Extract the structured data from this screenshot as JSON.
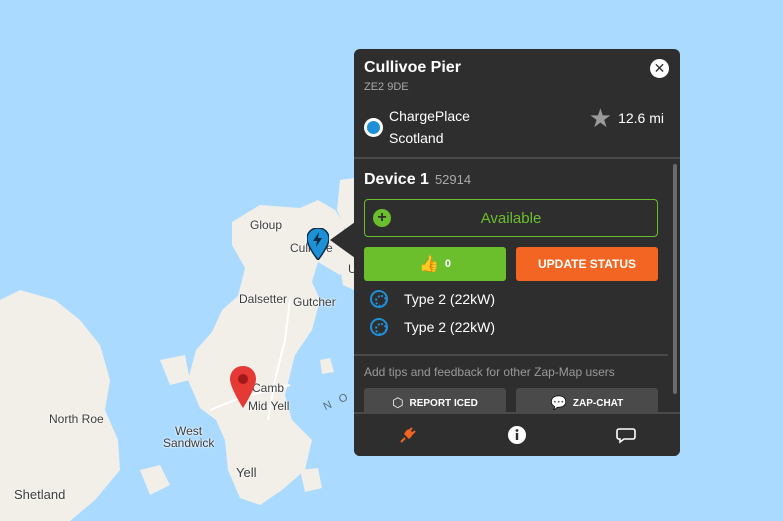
{
  "map": {
    "places": {
      "gloup": "Gloup",
      "cullivoe": "Cullivoe",
      "dalsetter": "Dalsetter",
      "gutcher": "Gutcher",
      "camb": "Camb",
      "mid_yell": "Mid Yell",
      "north_roe": "North Roe",
      "west_sandwick_1": "West",
      "west_sandwick_2": "Sandwick",
      "yell": "Yell",
      "shetland": "Shetland",
      "u_partial": "U",
      "sound_partial": "N O R"
    },
    "colors": {
      "water": "#aadaff",
      "land": "#f2efe9",
      "selected_pin": "#e53935",
      "charger_pin": "#1e90d6"
    }
  },
  "popup": {
    "title": "Cullivoe Pier",
    "postcode": "ZE2 9DE",
    "close_icon": "close-icon",
    "network": {
      "name": "ChargePlace Scotland",
      "icon": "network-logo-icon"
    },
    "distance": "12.6 mi",
    "device": {
      "label": "Device 1",
      "id": "52914",
      "status": "Available",
      "likes": "0",
      "update_label": "UPDATE STATUS",
      "connectors": [
        {
          "label": "Type 2 (22kW)",
          "icon": "type2-connector-icon"
        },
        {
          "label": "Type 2 (22kW)",
          "icon": "type2-connector-icon"
        }
      ]
    },
    "feedback": {
      "prompt": "Add tips and feedback for other Zap-Map users",
      "report_label": "REPORT ICED",
      "chat_label": "ZAP-CHAT"
    },
    "tabs": [
      {
        "name": "charging",
        "icon": "plug-icon"
      },
      {
        "name": "info",
        "icon": "info-icon"
      },
      {
        "name": "comments",
        "icon": "chat-icon"
      }
    ],
    "colors": {
      "available": "#6bbf2c",
      "update": "#f26522",
      "background": "#2e2e2e"
    }
  }
}
